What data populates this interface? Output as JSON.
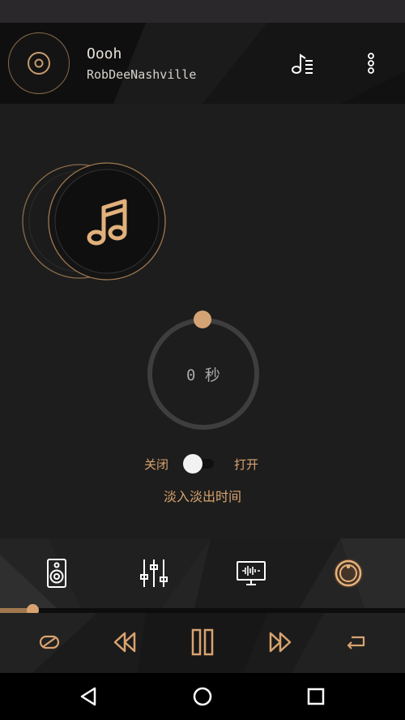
{
  "now_playing": {
    "title": "Oooh",
    "artist": "RobDeeNashville"
  },
  "header": {
    "disc_icon": "vinyl-disc-icon",
    "playlist_icon": "playlist-icon",
    "menu_icon": "more-vert-icon"
  },
  "album_art_icon": "music-note-icon",
  "fade_knob": {
    "value_text": "0 秒",
    "value_seconds": 0
  },
  "fade_toggle": {
    "off_label": "关闭",
    "on_label": "打开",
    "state": "off"
  },
  "fade_caption": "淡入淡出时间",
  "effects_bar": [
    {
      "icon": "speaker-icon"
    },
    {
      "icon": "equalizer-sliders-icon"
    },
    {
      "icon": "visualizer-monitor-icon"
    },
    {
      "icon": "fade-knob-icon",
      "active": true
    }
  ],
  "progress": {
    "fraction": 0.08
  },
  "controls": [
    {
      "icon": "shuffle-mode-icon"
    },
    {
      "icon": "rewind-icon"
    },
    {
      "icon": "pause-icon"
    },
    {
      "icon": "fast-forward-icon"
    },
    {
      "icon": "repeat-icon"
    }
  ],
  "nav": [
    "back-icon",
    "home-icon",
    "recents-icon"
  ],
  "colors": {
    "accent": "#d9a36f",
    "accent_dark": "#a07850",
    "background": "#1c1c1c"
  }
}
